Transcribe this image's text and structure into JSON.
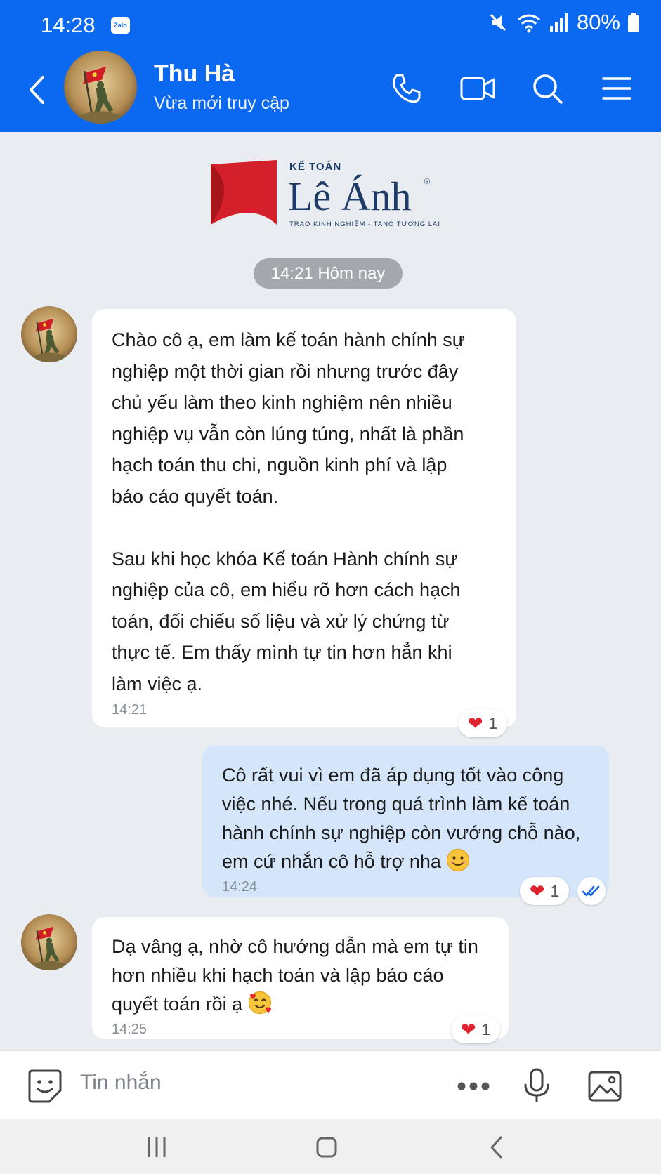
{
  "status_bar": {
    "time": "14:28",
    "app_badge": "Zalo",
    "battery": "80%"
  },
  "header": {
    "contact_name": "Thu Hà",
    "contact_status": "Vừa mới truy cập"
  },
  "banner": {
    "brand_small": "KẾ TOÁN",
    "brand_name": "Lê Ánh",
    "registered": "®",
    "tagline": "TRAO KINH NGHIỆM - TANO TƯƠNG LAI"
  },
  "date_separator": "14:21 Hôm nay",
  "messages": [
    {
      "direction": "incoming",
      "text": "Chào cô ạ, em làm kế toán hành chính sự\nnghiệp một thời gian rồi nhưng trước đây\nchủ yếu làm theo kinh nghiệm nên nhiều\nnghiệp vụ vẫn còn lúng túng, nhất là phần\nhạch toán thu chi, nguồn kinh phí và lập\nbáo cáo quyết toán.\n\nSau khi học khóa Kế toán Hành chính sự\nnghiệp của cô, em hiểu rõ hơn cách hạch\ntoán, đối chiếu số liệu và xử lý chứng từ\nthực tế. Em thấy mình tự tin hơn hẳn khi\nlàm việc ạ.",
      "time": "14:21",
      "reaction_count": "1"
    },
    {
      "direction": "outgoing",
      "text": "Cô rất vui vì em đã áp dụng tốt vào công\nviệc nhé. Nếu trong quá trình làm kế toán\nhành chính sự nghiệp còn vướng chỗ nào,\nem cứ nhắn cô hỗ trợ nha",
      "time": "14:24",
      "reaction_count": "1",
      "emoji": "smiling-face"
    },
    {
      "direction": "incoming",
      "text": "Dạ vâng ạ, nhờ cô hướng dẫn mà em tự tin\nhơn nhiều khi hạch toán và lập báo cáo\nquyết toán rồi ạ",
      "time": "14:25",
      "reaction_count": "1",
      "emoji": "smiling-face-with-hearts"
    }
  ],
  "input_bar": {
    "placeholder": "Tin nhắn"
  },
  "colors": {
    "header_blue": "#0b68f0",
    "outgoing_bubble": "#d5e6fb",
    "reaction_heart": "#e0222f",
    "logo_red": "#d4202a",
    "logo_navy": "#1d3b66"
  }
}
